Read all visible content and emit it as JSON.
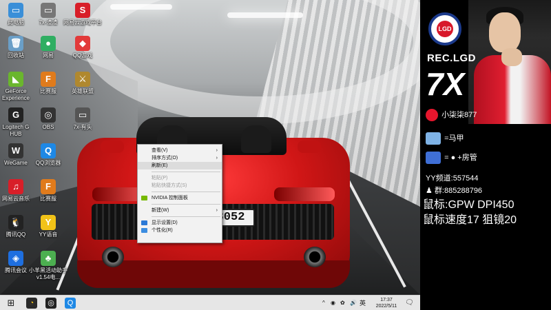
{
  "desktop": {
    "icons": [
      {
        "name": "此电脑",
        "glyph": "▭",
        "color": "#3a8fd8"
      },
      {
        "name": "7x-渣渣",
        "glyph": "▭",
        "color": "#777"
      },
      {
        "name": "网易云游戏平台",
        "glyph": "S",
        "color": "#d81e28"
      },
      {
        "name": "回收站",
        "glyph": "🗑",
        "color": "#6a9fc8"
      },
      {
        "name": "网易",
        "glyph": "●",
        "color": "#2fae62"
      },
      {
        "name": "QQ游戏",
        "glyph": "◆",
        "color": "#e23a3a"
      },
      {
        "name": "GeForce Experience",
        "glyph": "◣",
        "color": "#6ab62d"
      },
      {
        "name": "比赛服",
        "glyph": "F",
        "color": "#e07b1c"
      },
      {
        "name": "英雄联盟",
        "glyph": "⚔",
        "color": "#b0882e"
      },
      {
        "name": "Logitech G HUB",
        "glyph": "G",
        "color": "#222"
      },
      {
        "name": "OBS",
        "glyph": "◎",
        "color": "#333"
      },
      {
        "name": "7x-有头",
        "glyph": "▭",
        "color": "#555"
      },
      {
        "name": "WeGame",
        "glyph": "W",
        "color": "#333"
      },
      {
        "name": "QQ浏览器",
        "glyph": "Q",
        "color": "#1e88e5"
      },
      {
        "name": "网易云音乐",
        "glyph": "♫",
        "color": "#d81e28"
      },
      {
        "name": "比赛服",
        "glyph": "F",
        "color": "#e07b1c"
      },
      {
        "name": "腾讯QQ",
        "glyph": "🐧",
        "color": "#222"
      },
      {
        "name": "YY语音",
        "glyph": "Y",
        "color": "#f2c318"
      },
      {
        "name": "腾讯会议",
        "glyph": "◈",
        "color": "#1e6fe0"
      },
      {
        "name": "小羊黑活动助手v1.54电...",
        "glyph": "♣",
        "color": "#4caf50"
      }
    ],
    "plate_text": "3052"
  },
  "context_menu": {
    "items": [
      {
        "label": "查看(V)",
        "arrow": "›",
        "disabled": false
      },
      {
        "label": "排序方式(O)",
        "arrow": "›",
        "disabled": false
      },
      {
        "label": "刷新(E)",
        "arrow": "",
        "disabled": false
      },
      {
        "label": "粘贴(P)",
        "arrow": "",
        "disabled": true
      },
      {
        "label": "粘贴快捷方式(S)",
        "arrow": "",
        "disabled": true
      },
      {
        "label": "NVIDIA 控制面板",
        "arrow": "",
        "disabled": false
      },
      {
        "label": "新建(W)",
        "arrow": "›",
        "disabled": false
      },
      {
        "label": "显示设置(D)",
        "arrow": "",
        "disabled": false
      },
      {
        "label": "个性化(R)",
        "arrow": "",
        "disabled": false
      }
    ]
  },
  "taskbar": {
    "tray_up": "^",
    "ime": "英",
    "time": "17:37",
    "date": "2022/5/11"
  },
  "overlay": {
    "team_name": "REC.LGD",
    "logo_text": "LGD",
    "player_number": "7X",
    "weibo": "小柒柒877",
    "line_mount": "=马甲",
    "line_wechat": "=",
    "line_wechat_suffix": "+房管",
    "yy_channel": "YY频道:557544",
    "qq_group": "群:885288796",
    "mouse": "鼠标:GPW DPI450",
    "mouse_speed": "鼠标速度17 狙镜20"
  }
}
